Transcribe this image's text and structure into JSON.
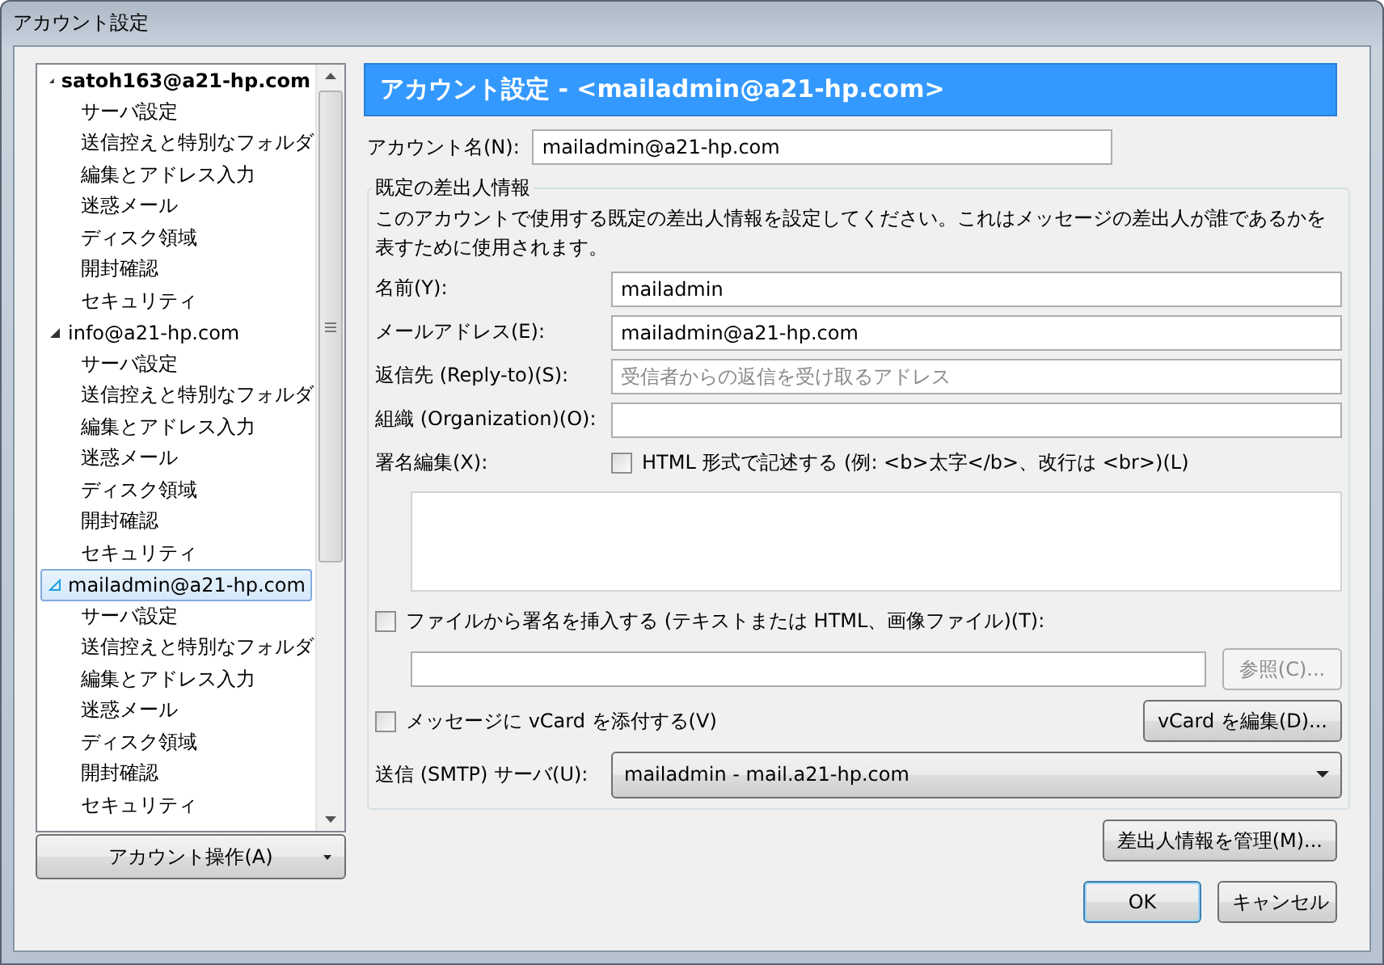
{
  "window": {
    "title": "アカウント設定"
  },
  "account_tree": {
    "items": [
      {
        "label": "satoh163@a21-hp.com",
        "default": true,
        "expanded": true,
        "selected": false,
        "children": [
          {
            "label": "サーバ設定",
            "selected": false
          },
          {
            "label": "送信控えと特別なフォルダ",
            "selected": false
          },
          {
            "label": "編集とアドレス入力",
            "selected": false
          },
          {
            "label": "迷惑メール",
            "selected": false
          },
          {
            "label": "ディスク領域",
            "selected": false
          },
          {
            "label": "開封確認",
            "selected": false
          },
          {
            "label": "セキュリティ",
            "selected": false
          }
        ]
      },
      {
        "label": "info@a21-hp.com",
        "default": false,
        "expanded": true,
        "selected": false,
        "children": [
          {
            "label": "サーバ設定",
            "selected": false
          },
          {
            "label": "送信控えと特別なフォルダ",
            "selected": false
          },
          {
            "label": "編集とアドレス入力",
            "selected": false
          },
          {
            "label": "迷惑メール",
            "selected": false
          },
          {
            "label": "ディスク領域",
            "selected": false
          },
          {
            "label": "開封確認",
            "selected": false
          },
          {
            "label": "セキュリティ",
            "selected": false
          }
        ]
      },
      {
        "label": "mailadmin@a21-hp.com",
        "default": false,
        "expanded": true,
        "selected": true,
        "children": [
          {
            "label": "サーバ設定",
            "selected": false
          },
          {
            "label": "送信控えと特別なフォルダ",
            "selected": false
          },
          {
            "label": "編集とアドレス入力",
            "selected": false
          },
          {
            "label": "迷惑メール",
            "selected": false
          },
          {
            "label": "ディスク領域",
            "selected": false
          },
          {
            "label": "開封確認",
            "selected": false
          },
          {
            "label": "セキュリティ",
            "selected": false
          }
        ]
      }
    ]
  },
  "account_actions_button": {
    "label": "アカウント操作(A)"
  },
  "header": {
    "title": "アカウント設定 - <mailadmin@a21-hp.com>"
  },
  "account_name": {
    "label": "アカウント名(N):",
    "value": "mailadmin@a21-hp.com"
  },
  "identity": {
    "legend": "既定の差出人情報",
    "description": "このアカウントで使用する既定の差出人情報を設定してください。これはメッセージの差出人が誰であるかを表すために使用されます。",
    "fields": [
      {
        "label": "名前(Y):",
        "value": "mailadmin"
      },
      {
        "label": "メールアドレス(E):",
        "value": "mailadmin@a21-hp.com"
      },
      {
        "label": "返信先 (Reply-to)(S):",
        "placeholder": "受信者からの返信を受け取るアドレス"
      },
      {
        "label": "組織 (Organization)(O):"
      }
    ],
    "signature": {
      "label": "署名編集(X):",
      "html_option": {
        "label": "HTML 形式で記述する (例: <b>太字</b>、改行は <br>)(L)",
        "checked": false
      }
    },
    "signature_file": {
      "label": "ファイルから署名を挿入する (テキストまたは HTML、画像ファイル)(T):",
      "checked": false,
      "browse_button": {
        "label": "参照(C)...",
        "disabled": true
      }
    },
    "vcard": {
      "label": "メッセージに vCard を添付する(V)",
      "checked": false,
      "edit_button": {
        "label": "vCard を編集(D)..."
      }
    },
    "smtp": {
      "label": "送信 (SMTP) サーバ(U):",
      "value": "mailadmin - mail.a21-hp.com"
    }
  },
  "manage_button": {
    "label": "差出人情報を管理(M)..."
  },
  "buttons": [
    {
      "label": "OK",
      "default": true
    },
    {
      "label": "キャンセル",
      "default": false
    }
  ]
}
